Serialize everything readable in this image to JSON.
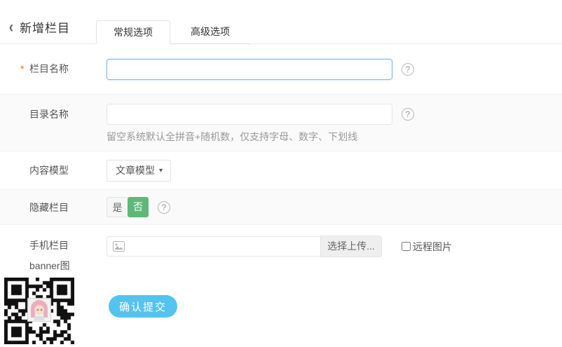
{
  "header": {
    "title": "新增栏目",
    "tabs": [
      {
        "label": "常规选项",
        "active": true
      },
      {
        "label": "高级选项",
        "active": false
      }
    ]
  },
  "icons": {
    "back": "‹",
    "help": "?",
    "dropdown": "▼",
    "image_icon_name": "image-placeholder-icon",
    "qr_name": "qrcode-with-avatar"
  },
  "required_marker": "*",
  "form": {
    "fields": {
      "column_name": {
        "label": "栏目名称",
        "required": true,
        "value": "",
        "placeholder": "",
        "focused": true
      },
      "dir_name": {
        "label": "目录名称",
        "value": "",
        "placeholder": "",
        "hint": "留空系统默认全拼音+随机数，仅支持字母、数字、下划线"
      },
      "content_model": {
        "label": "内容模型",
        "value": "文章模型"
      },
      "hide_column": {
        "label": "隐藏栏目",
        "options": [
          "是",
          "否"
        ],
        "selected": "否"
      },
      "mobile_banner": {
        "label_line1": "手机栏目",
        "label_line2": "banner图",
        "value": "",
        "upload_button": "选择上传...",
        "remote_label": "远程图片",
        "remote_checked": false
      }
    }
  },
  "footer": {
    "submit_label": "确认提交"
  },
  "colors": {
    "accent_blue": "#55C3EF",
    "success_green": "#5FB878",
    "required_orange": "#FF6600",
    "focus_border": "#7EB8E8",
    "row_alt_bg": "#FAFAFA"
  }
}
